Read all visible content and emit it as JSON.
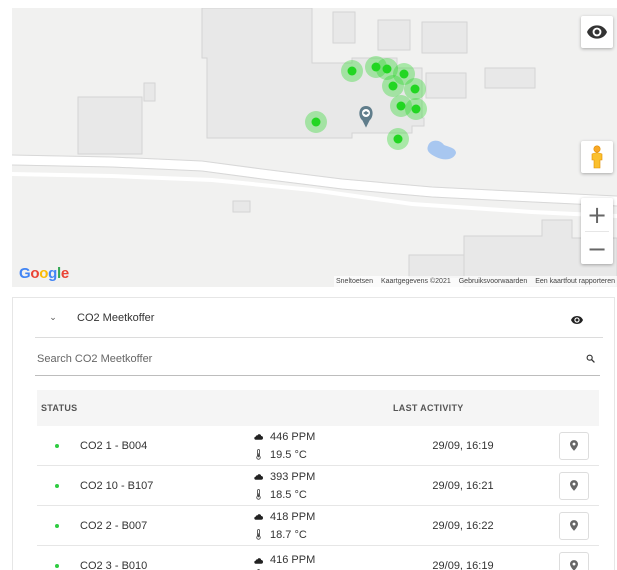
{
  "map": {
    "logo_letters": [
      {
        "ch": "G",
        "color": "#4285F4"
      },
      {
        "ch": "o",
        "color": "#EA4335"
      },
      {
        "ch": "o",
        "color": "#FBBC05"
      },
      {
        "ch": "g",
        "color": "#4285F4"
      },
      {
        "ch": "l",
        "color": "#34A853"
      },
      {
        "ch": "e",
        "color": "#EA4335"
      }
    ],
    "attribution": [
      "Sneltoetsen",
      "Kaartgegevens ©2021",
      "Gebruiksvoorwaarden",
      "Een kaartfout rapporteren"
    ],
    "zoom_in": "+",
    "zoom_out": "−",
    "marker_color": "#22d622",
    "icons": [
      "eye-icon",
      "pegman-icon",
      "map-pin-icon"
    ]
  },
  "panel": {
    "chevron": "⌄",
    "title": "CO2 Meetkoffer",
    "search_placeholder": "Search CO2 Meetkoffer",
    "columns": {
      "status": "STATUS",
      "last_activity": "LAST ACTIVITY"
    },
    "rows": [
      {
        "name": "CO2 1 - B004",
        "ppm": "446 PPM",
        "temp": "19.5 °C",
        "time": "29/09, 16:19"
      },
      {
        "name": "CO2 10 - B107",
        "ppm": "393 PPM",
        "temp": "18.5 °C",
        "time": "29/09, 16:21"
      },
      {
        "name": "CO2 2 - B007",
        "ppm": "418 PPM",
        "temp": "18.7 °C",
        "time": "29/09, 16:22"
      },
      {
        "name": "CO2 3 - B010",
        "ppm": "416 PPM",
        "temp": "",
        "time": "29/09, 16:19"
      }
    ],
    "status_color": "#2ecc40"
  }
}
